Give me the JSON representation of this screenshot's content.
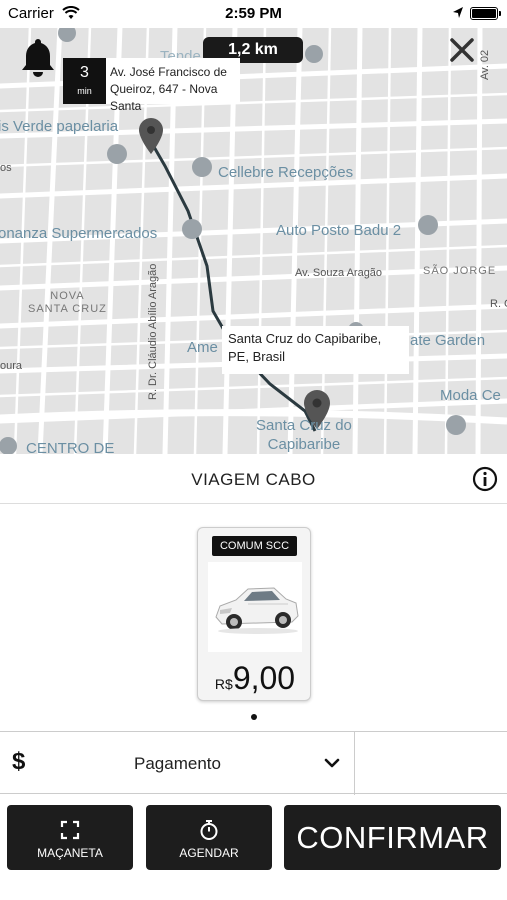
{
  "status_bar": {
    "carrier": "Carrier",
    "time": "2:59 PM"
  },
  "map": {
    "distance": "1,2 km",
    "eta": {
      "minutes": "3",
      "unit": "min",
      "address": "Av. José Francisco de Queiroz, 647 - Nova Santa"
    },
    "destination": "Santa Cruz do Capibaribe, PE, Brasil",
    "labels": {
      "papelaria": "is Verde papelaria",
      "cellebre": "Cellebre Recepções",
      "bonanza": "onanza Supermercados",
      "auto_posto": "Auto Posto Badu 2",
      "souza_aragao": "Av. Souza Aragão",
      "sao_jorge": "SÃO JORGE",
      "nova_santa_cruz": "NOVA\nSANTA CRUZ",
      "claudio": "R. Dr. Cláudio Abílio Aragão",
      "ame": "Ame",
      "ate_garden": "ate Garden",
      "moda": "Moda Ce",
      "santa_cruz": "Santa Cruz do\nCapibaribe",
      "centro": "CENTRO DE",
      "oura": "oura",
      "os": "os",
      "r_c": "R. C",
      "av02": "Av. 02",
      "tende": "Tende"
    }
  },
  "trip": {
    "title": "VIAGEM CABO"
  },
  "vehicle": {
    "category": "COMUM SCC",
    "currency": "R$",
    "price": "9,00"
  },
  "payment": {
    "icon": "$",
    "label": "Pagamento"
  },
  "buttons": {
    "macaneta": "MAÇANETA",
    "agendar": "AGENDAR",
    "confirmar": "CONFIRMAR"
  },
  "colors": {
    "dark": "#1d1d1d",
    "map_bg": "#e3e3e3",
    "poi_label": "#6b8fa3",
    "route": "#2b3a40"
  },
  "icons": {
    "bell": "bell-icon",
    "close": "close-icon",
    "info": "info-icon",
    "chevron": "chevron-down-icon",
    "expand": "expand-icon",
    "timer": "timer-icon"
  }
}
